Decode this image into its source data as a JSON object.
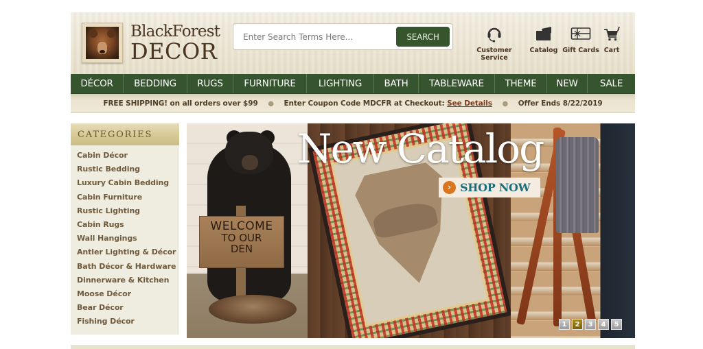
{
  "header": {
    "logo": {
      "line1": "BlackForest",
      "line2": "DECOR"
    },
    "search": {
      "placeholder": "Enter Search Terms Here...",
      "value": "",
      "button_label": "SEARCH"
    },
    "utility_links": [
      {
        "label": "Customer Service",
        "icon": "headset-icon"
      },
      {
        "label": "Catalog",
        "icon": "catalog-icon"
      },
      {
        "label": "Gift Cards",
        "icon": "gift-card-icon"
      },
      {
        "label": "Cart",
        "icon": "cart-icon"
      }
    ]
  },
  "nav": {
    "items": [
      "DÉCOR",
      "BEDDING",
      "RUGS",
      "FURNITURE",
      "LIGHTING",
      "BATH",
      "TABLEWARE",
      "THEME",
      "NEW",
      "SALE"
    ]
  },
  "promo": {
    "shipping": "FREE SHIPPING! on all orders over $99",
    "coupon": "Enter Coupon Code MDCFR at Checkout:",
    "details_link": "See Details",
    "offer": "Offer Ends 8/22/2019"
  },
  "sidebar": {
    "title": "CATEGORIES",
    "items": [
      "Cabin Décor",
      "Rustic Bedding",
      "Luxury Cabin Bedding",
      "Cabin Furniture",
      "Rustic Lighting",
      "Cabin Rugs",
      "Wall Hangings",
      "Antler Lighting & Décor",
      "Bath Décor & Hardware",
      "Dinnerware & Kitchen",
      "Moose Décor",
      "Bear Décor",
      "Fishing Décor"
    ]
  },
  "banner": {
    "title": "New Catalog",
    "cta_label": "SHOP NOW",
    "sign_text": {
      "line1": "WELCOME",
      "line2": "TO OUR",
      "line3": "DEN"
    },
    "slides": [
      "1",
      "2",
      "3",
      "4",
      "5"
    ],
    "active_slide": 2
  },
  "colors": {
    "nav_green": "#36552f",
    "search_button": "#36552c",
    "cta_orange": "#d9761f",
    "cta_teal": "#1d6e7b",
    "brand_brown": "#4a3520",
    "slide_active": "#a88a1c"
  }
}
